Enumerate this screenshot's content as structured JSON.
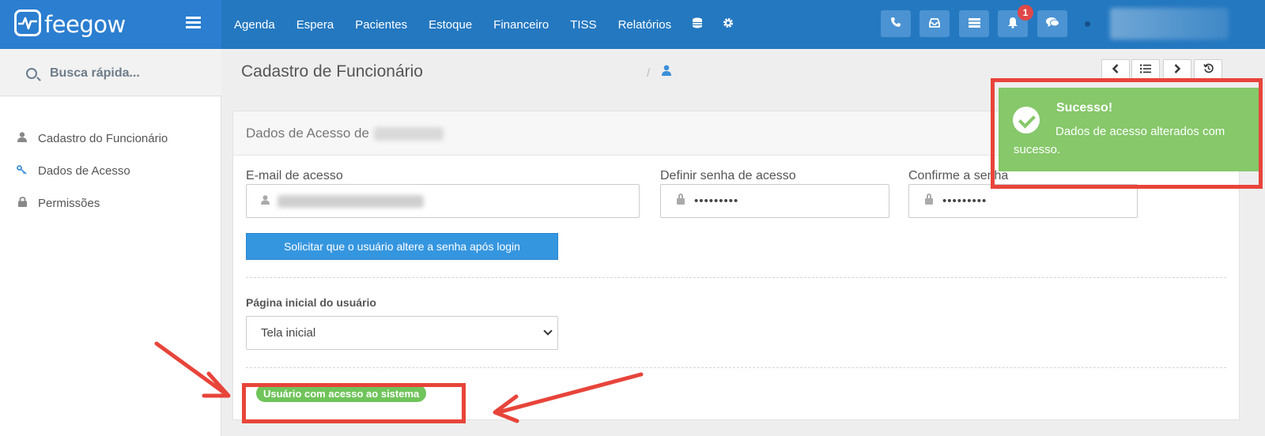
{
  "brand": {
    "name": "feegow"
  },
  "nav": {
    "items": [
      "Agenda",
      "Espera",
      "Pacientes",
      "Estoque",
      "Financeiro",
      "TISS",
      "Relatórios"
    ],
    "notification_count": "1"
  },
  "sidebar": {
    "search_placeholder": "Busca rápida...",
    "items": [
      "Cadastro do Funcionário",
      "Dados de Acesso",
      "Permissões"
    ]
  },
  "header": {
    "title": "Cadastro de Funcionário",
    "breadcrumb_sep": "/"
  },
  "panel": {
    "title": "Dados de Acesso de",
    "email_label": "E-mail de acesso",
    "password_label": "Definir senha de acesso",
    "password_value": "•••••••••",
    "confirm_label": "Confirme a senha",
    "confirm_value": "•••••••••",
    "force_change_button": "Solicitar que o usuário altere a senha após login",
    "home_page_label": "Página inicial do usuário",
    "home_page_value": "Tela inicial",
    "access_status": "Usuário com acesso ao sistema"
  },
  "toast": {
    "title": "Sucesso!",
    "message": "Dados de acesso alterados com sucesso."
  },
  "colors": {
    "topbar": "#2478c0",
    "primary_button": "#3596e0",
    "success": "#86c86a",
    "status_badge": "#6fc45a",
    "annotation": "#e8443a"
  }
}
